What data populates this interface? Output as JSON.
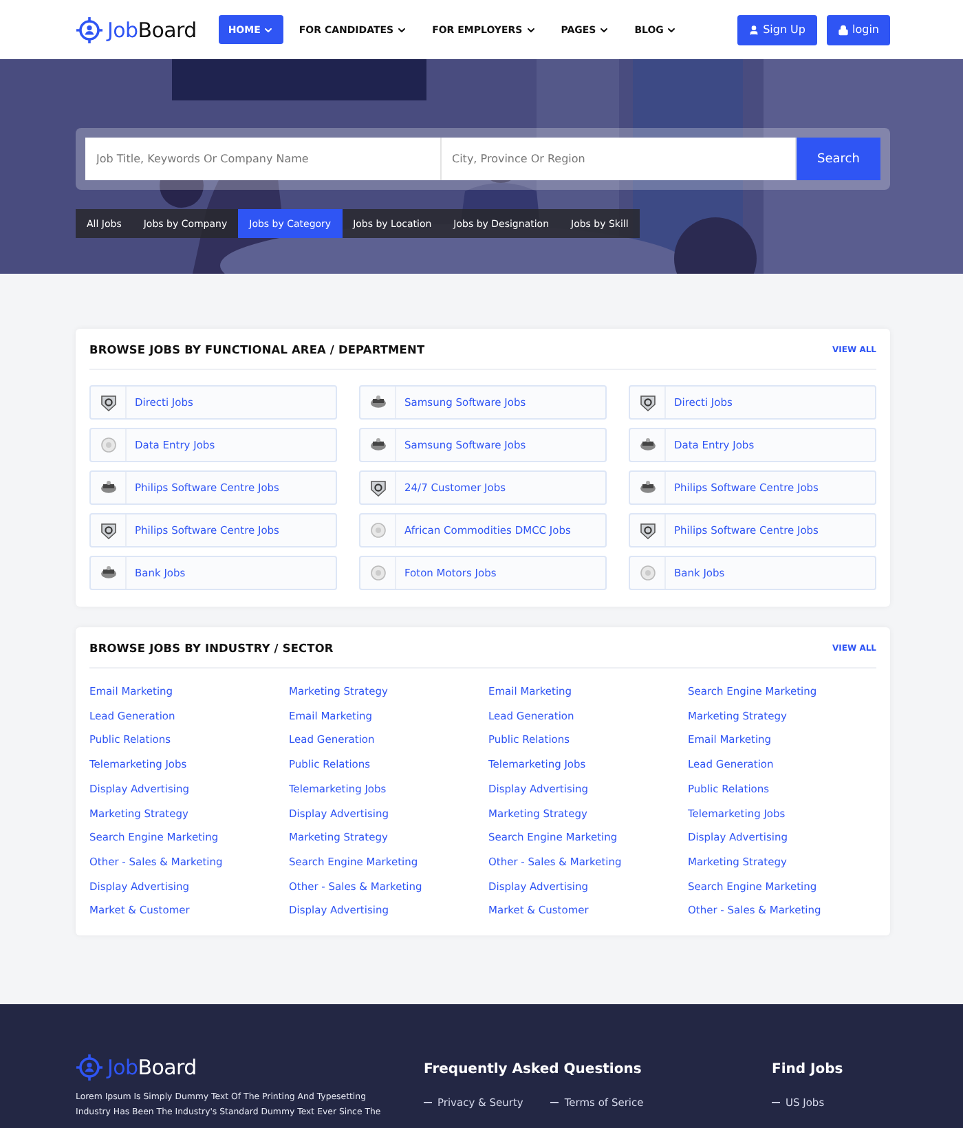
{
  "header": {
    "logo": {
      "first": "Job",
      "second": "Board"
    },
    "nav": [
      {
        "label": "HOME",
        "selected": true
      },
      {
        "label": "FOR CANDIDATES",
        "selected": false
      },
      {
        "label": "FOR EMPLOYERS",
        "selected": false
      },
      {
        "label": "PAGES",
        "selected": false
      },
      {
        "label": "BLOG",
        "selected": false
      }
    ],
    "buttons": [
      {
        "label": "Sign Up",
        "kind": "user"
      },
      {
        "label": "login",
        "kind": "lock"
      }
    ]
  },
  "hero": {
    "search": {
      "keyword_placeholder": "Job Title, Keywords Or Company Name",
      "location_placeholder": "City, Province Or Region",
      "button": "Search"
    },
    "tabs": [
      {
        "label": "All Jobs",
        "selected": false
      },
      {
        "label": "Jobs by Company",
        "selected": false
      },
      {
        "label": "Jobs by Category",
        "selected": true
      },
      {
        "label": "Jobs by Location",
        "selected": false
      },
      {
        "label": "Jobs by Designation",
        "selected": false
      },
      {
        "label": "Jobs by Skill",
        "selected": false
      }
    ]
  },
  "functional_area": {
    "title": "BROWSE JOBS BY FUNCTIONAL AREA / DEPARTMENT",
    "view_all": "VIEW ALL",
    "items": [
      "Directi Jobs",
      "Samsung Software Jobs",
      "Directi Jobs",
      "Data Entry Jobs",
      "Samsung Software Jobs",
      "Data Entry Jobs",
      "Philips Software Centre Jobs",
      "24/7 Customer Jobs",
      "Philips Software Centre Jobs",
      "Philips Software Centre Jobs",
      "African Commodities DMCC Jobs",
      "Philips Software Centre Jobs",
      "Bank Jobs",
      "Foton Motors Jobs",
      "Bank Jobs"
    ]
  },
  "industry": {
    "title": "BROWSE JOBS BY INDUSTRY / SECTOR",
    "view_all": "VIEW ALL",
    "columns": [
      [
        "Email Marketing",
        "Lead Generation",
        "Public Relations",
        "Telemarketing Jobs",
        "Display Advertising",
        "Marketing Strategy",
        "Search Engine Marketing",
        "Other - Sales & Marketing",
        "Display Advertising",
        "Market & Customer"
      ],
      [
        "Marketing Strategy",
        "Email Marketing",
        "Lead Generation",
        "Public Relations",
        "Telemarketing Jobs",
        "Display Advertising",
        "Marketing Strategy",
        "Search Engine Marketing",
        "Other - Sales & Marketing",
        "Display Advertising"
      ],
      [
        "Email Marketing",
        "Lead Generation",
        "Public Relations",
        "Telemarketing Jobs",
        "Display Advertising",
        "Marketing Strategy",
        "Search Engine Marketing",
        "Other - Sales & Marketing",
        "Display Advertising",
        "Market & Customer"
      ],
      [
        "Search Engine Marketing",
        "Marketing Strategy",
        "Email Marketing",
        "Lead Generation",
        "Public Relations",
        "Telemarketing Jobs",
        "Display Advertising",
        "Marketing Strategy",
        "Search Engine Marketing",
        "Other - Sales & Marketing"
      ]
    ]
  },
  "footer": {
    "logo": {
      "first": "Job",
      "second": "Board"
    },
    "about": "Lorem Ipsum Is Simply Dummy Text Of The Printing And Typesetting Industry Has Been The Industry's Standard Dummy Text Ever Since The",
    "faq": {
      "title": "Frequently Asked Questions",
      "links": [
        "Privacy & Seurty",
        "Terms of Serice"
      ]
    },
    "find_jobs": {
      "title": "Find Jobs",
      "links": [
        "US Jobs"
      ]
    }
  }
}
